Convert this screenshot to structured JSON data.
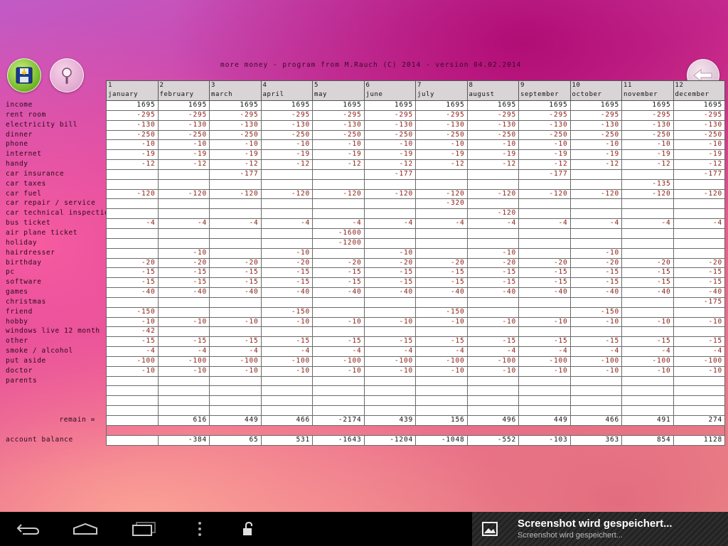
{
  "header": {
    "title": "more money - program from M.Rauch (C) 2014 - version 04.02.2014"
  },
  "toolbar": {
    "save_icon": "floppy-disk-icon",
    "search_icon": "magnifier-icon",
    "back_icon": "back-arrow-icon"
  },
  "months": [
    {
      "num": "1",
      "name": "january"
    },
    {
      "num": "2",
      "name": "february"
    },
    {
      "num": "3",
      "name": "march"
    },
    {
      "num": "4",
      "name": "april"
    },
    {
      "num": "5",
      "name": "may"
    },
    {
      "num": "6",
      "name": "june"
    },
    {
      "num": "7",
      "name": "july"
    },
    {
      "num": "8",
      "name": "august"
    },
    {
      "num": "9",
      "name": "september"
    },
    {
      "num": "10",
      "name": "october"
    },
    {
      "num": "11",
      "name": "november"
    },
    {
      "num": "12",
      "name": "december"
    }
  ],
  "rows": [
    {
      "label": "income",
      "values": [
        "1695",
        "1695",
        "1695",
        "1695",
        "1695",
        "1695",
        "1695",
        "1695",
        "1695",
        "1695",
        "1695",
        "1695"
      ]
    },
    {
      "label": "rent room",
      "values": [
        "-295",
        "-295",
        "-295",
        "-295",
        "-295",
        "-295",
        "-295",
        "-295",
        "-295",
        "-295",
        "-295",
        "-295"
      ]
    },
    {
      "label": "electricity bill",
      "values": [
        "-130",
        "-130",
        "-130",
        "-130",
        "-130",
        "-130",
        "-130",
        "-130",
        "-130",
        "-130",
        "-130",
        "-130"
      ]
    },
    {
      "label": "dinner",
      "values": [
        "-250",
        "-250",
        "-250",
        "-250",
        "-250",
        "-250",
        "-250",
        "-250",
        "-250",
        "-250",
        "-250",
        "-250"
      ]
    },
    {
      "label": "phone",
      "values": [
        "-10",
        "-10",
        "-10",
        "-10",
        "-10",
        "-10",
        "-10",
        "-10",
        "-10",
        "-10",
        "-10",
        "-10"
      ]
    },
    {
      "label": "internet",
      "values": [
        "-19",
        "-19",
        "-19",
        "-19",
        "-19",
        "-19",
        "-19",
        "-19",
        "-19",
        "-19",
        "-19",
        "-19"
      ]
    },
    {
      "label": "handy",
      "values": [
        "-12",
        "-12",
        "-12",
        "-12",
        "-12",
        "-12",
        "-12",
        "-12",
        "-12",
        "-12",
        "-12",
        "-12"
      ]
    },
    {
      "label": "car insurance",
      "values": [
        "",
        "",
        "-177",
        "",
        "",
        "-177",
        "",
        "",
        "-177",
        "",
        "",
        "-177"
      ]
    },
    {
      "label": "car taxes",
      "values": [
        "",
        "",
        "",
        "",
        "",
        "",
        "",
        "",
        "",
        "",
        "-135",
        ""
      ]
    },
    {
      "label": "car fuel",
      "values": [
        "-120",
        "-120",
        "-120",
        "-120",
        "-120",
        "-120",
        "-120",
        "-120",
        "-120",
        "-120",
        "-120",
        "-120"
      ]
    },
    {
      "label": "car repair / service",
      "values": [
        "",
        "",
        "",
        "",
        "",
        "",
        "-320",
        "",
        "",
        "",
        "",
        ""
      ]
    },
    {
      "label": "car technical inspection",
      "values": [
        "",
        "",
        "",
        "",
        "",
        "",
        "",
        "-120",
        "",
        "",
        "",
        ""
      ]
    },
    {
      "label": "bus ticket",
      "values": [
        "-4",
        "-4",
        "-4",
        "-4",
        "-4",
        "-4",
        "-4",
        "-4",
        "-4",
        "-4",
        "-4",
        "-4"
      ]
    },
    {
      "label": "air plane ticket",
      "values": [
        "",
        "",
        "",
        "",
        "-1600",
        "",
        "",
        "",
        "",
        "",
        "",
        ""
      ]
    },
    {
      "label": "holiday",
      "values": [
        "",
        "",
        "",
        "",
        "-1200",
        "",
        "",
        "",
        "",
        "",
        "",
        ""
      ]
    },
    {
      "label": "hairdresser",
      "values": [
        "",
        "-10",
        "",
        "-10",
        "",
        "-10",
        "",
        "-10",
        "",
        "-10",
        "",
        ""
      ]
    },
    {
      "label": "birthday",
      "values": [
        "-20",
        "-20",
        "-20",
        "-20",
        "-20",
        "-20",
        "-20",
        "-20",
        "-20",
        "-20",
        "-20",
        "-20"
      ]
    },
    {
      "label": "pc",
      "values": [
        "-15",
        "-15",
        "-15",
        "-15",
        "-15",
        "-15",
        "-15",
        "-15",
        "-15",
        "-15",
        "-15",
        "-15"
      ]
    },
    {
      "label": "software",
      "values": [
        "-15",
        "-15",
        "-15",
        "-15",
        "-15",
        "-15",
        "-15",
        "-15",
        "-15",
        "-15",
        "-15",
        "-15"
      ]
    },
    {
      "label": "games",
      "values": [
        "-40",
        "-40",
        "-40",
        "-40",
        "-40",
        "-40",
        "-40",
        "-40",
        "-40",
        "-40",
        "-40",
        "-40"
      ]
    },
    {
      "label": "christmas",
      "values": [
        "",
        "",
        "",
        "",
        "",
        "",
        "",
        "",
        "",
        "",
        "",
        "-175"
      ]
    },
    {
      "label": "friend",
      "values": [
        "-150",
        "",
        "",
        "-150",
        "",
        "",
        "-150",
        "",
        "",
        "-150",
        "",
        ""
      ]
    },
    {
      "label": "hobby",
      "values": [
        "-10",
        "-10",
        "-10",
        "-10",
        "-10",
        "-10",
        "-10",
        "-10",
        "-10",
        "-10",
        "-10",
        "-10"
      ]
    },
    {
      "label": "windows live 12 month",
      "values": [
        "-42",
        "",
        "",
        "",
        "",
        "",
        "",
        "",
        "",
        "",
        "",
        ""
      ]
    },
    {
      "label": "other",
      "values": [
        "-15",
        "-15",
        "-15",
        "-15",
        "-15",
        "-15",
        "-15",
        "-15",
        "-15",
        "-15",
        "-15",
        "-15"
      ]
    },
    {
      "label": "smoke / alcohol",
      "values": [
        "-4",
        "-4",
        "-4",
        "-4",
        "-4",
        "-4",
        "-4",
        "-4",
        "-4",
        "-4",
        "-4",
        "-4"
      ]
    },
    {
      "label": "put aside",
      "values": [
        "-100",
        "-100",
        "-100",
        "-100",
        "-100",
        "-100",
        "-100",
        "-100",
        "-100",
        "-100",
        "-100",
        "-100"
      ]
    },
    {
      "label": "doctor",
      "values": [
        "-10",
        "-10",
        "-10",
        "-10",
        "-10",
        "-10",
        "-10",
        "-10",
        "-10",
        "-10",
        "-10",
        "-10"
      ]
    },
    {
      "label": "parents",
      "values": [
        "",
        "",
        "",
        "",
        "",
        "",
        "",
        "",
        "",
        "",
        "",
        ""
      ]
    },
    {
      "label": "",
      "values": [
        "",
        "",
        "",
        "",
        "",
        "",
        "",
        "",
        "",
        "",
        "",
        ""
      ]
    },
    {
      "label": "",
      "values": [
        "",
        "",
        "",
        "",
        "",
        "",
        "",
        "",
        "",
        "",
        "",
        ""
      ]
    },
    {
      "label": "",
      "values": [
        "",
        "",
        "",
        "",
        "",
        "",
        "",
        "",
        "",
        "",
        "",
        ""
      ]
    },
    {
      "label": "remain =",
      "type": "sum",
      "values": [
        "",
        "616",
        "449",
        "466",
        "-2174",
        "439",
        "156",
        "496",
        "449",
        "466",
        "491",
        "274"
      ]
    },
    {
      "label": "",
      "type": "blank",
      "values": [
        "",
        "",
        "",
        "",
        "",
        "",
        "",
        "",
        "",
        "",
        "",
        ""
      ]
    },
    {
      "label": "account balance",
      "type": "sum",
      "values": [
        "",
        "-384",
        "65",
        "531",
        "-1643",
        "-1204",
        "-1048",
        "-552",
        "-103",
        "363",
        "854",
        "1128"
      ]
    }
  ],
  "navbar": {
    "icons": [
      "back-icon",
      "home-icon",
      "recent-apps-icon",
      "overflow-menu-icon",
      "unlock-icon"
    ]
  },
  "notification": {
    "icon": "image-icon",
    "title": "Screenshot wird gespeichert...",
    "subtitle": "Screenshot wird gespeichert..."
  },
  "colors": {
    "negative_value": "#8a1c12",
    "positive_value": "#111111",
    "header_cell": "#d9d4d6"
  }
}
